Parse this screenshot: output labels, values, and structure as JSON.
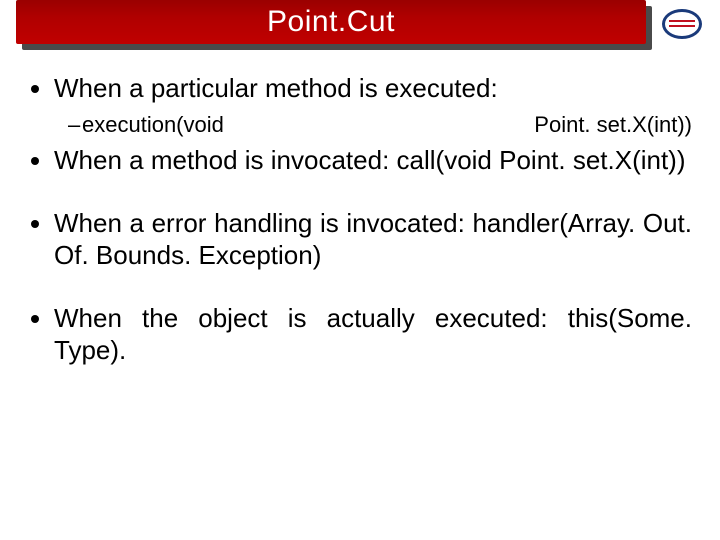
{
  "slide": {
    "title": "Point.Cut",
    "logo_name": "globe-logo"
  },
  "bullets": {
    "b1": {
      "text": "When a particular method is executed:",
      "sub_left": "execution(void",
      "sub_right": "Point. set.X(int))"
    },
    "b2": "When a method is invocated: call(void Point. set.X(int))",
    "b3": "When a error handling is invocated: handler(Array. Out. Of. Bounds. Exception)",
    "b4": "When the object is actually executed: this(Some. Type)."
  }
}
